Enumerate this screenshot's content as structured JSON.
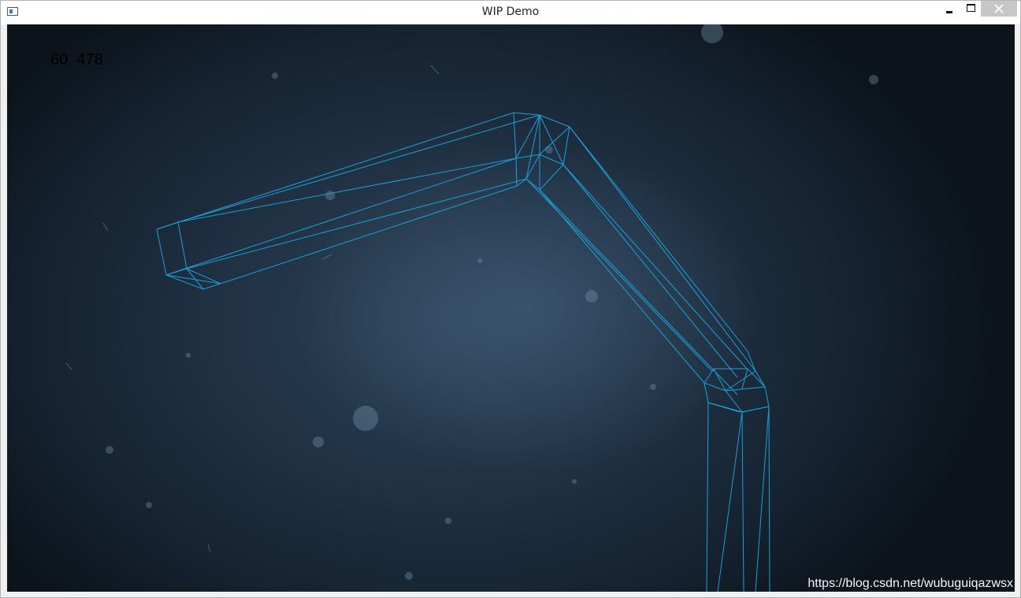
{
  "window": {
    "title": "WIP Demo",
    "icon": "app-window-icon"
  },
  "controls": {
    "minimize_icon": "minimize-icon",
    "maximize_icon": "maximize-icon",
    "close_label": "✕"
  },
  "viewport": {
    "fps_counter": "60. 478",
    "watermark": "https://blog.csdn.net/wubuguiqazwsx",
    "wireframe_color": "#1e9fd6",
    "background_color": "#1f3042"
  }
}
